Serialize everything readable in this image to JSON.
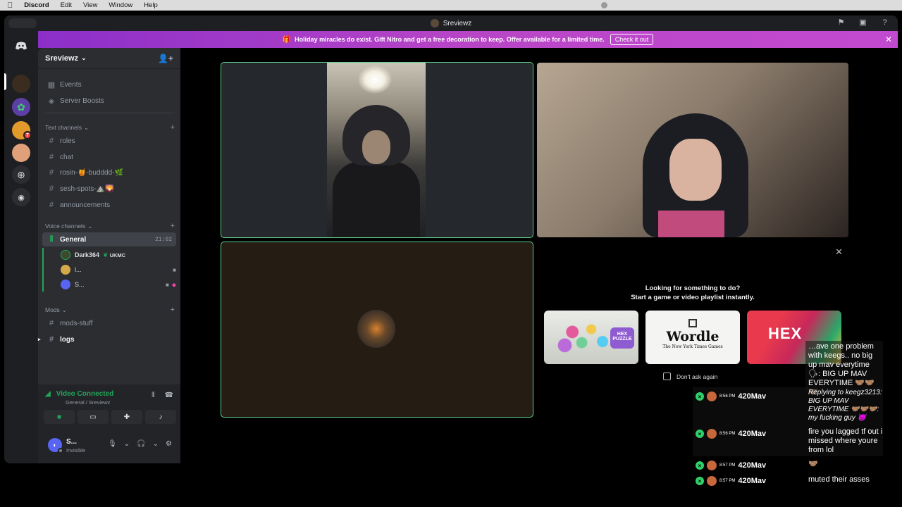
{
  "menubar": {
    "apple": "",
    "app": "Discord",
    "items": [
      "Edit",
      "View",
      "Window",
      "Help"
    ]
  },
  "window": {
    "title": "Sreviewz"
  },
  "banner": {
    "text": "Holiday miracles do exist. Gift Nitro and get a free decoration to keep. Offer available for a limited time.",
    "cta": "Check it out"
  },
  "server": {
    "name": "Sreviewz",
    "top_items": [
      "Events",
      "Server Boosts"
    ],
    "text_category": "Text channels",
    "text_channels": [
      "roles",
      "chat",
      "rosin-🍯-budddd-🌿",
      "sesh-spots-⛰️🌄",
      "announcements"
    ],
    "voice_category": "Voice channels",
    "voice_channel": {
      "name": "General",
      "time": "21:02"
    },
    "voice_users": [
      {
        "name": "Dark364",
        "tag": "UKMC"
      },
      {
        "name": "l..."
      },
      {
        "name": "S..."
      }
    ],
    "mods_category": "Mods",
    "mods_channels": [
      "mods-stuff",
      "logs"
    ]
  },
  "voice_status": {
    "status": "Video Connected",
    "sub": "General / Sreviewz"
  },
  "user": {
    "name": "S...",
    "status": "Invisible"
  },
  "guild_badge": "7",
  "activity": {
    "title_line1": "Looking for something to do?",
    "title_line2": "Start a game or video playlist instantly.",
    "cards": [
      "HEX PUZZLE",
      "Wordle",
      "HEX"
    ],
    "wordle_sub": "The New York Times Games",
    "dont_ask": "Don't ask again"
  },
  "chat_overlay": [
    {
      "time": "",
      "name": "",
      "text": "…ave one problem with keegs.. no big up mav everytime 🗣: BIG UP MAV EVERYTIME 🤝🏽🤝🏽🤝🏽",
      "italic": false
    },
    {
      "time": "8:56 PM",
      "name": "420Mav",
      "text": "Replying to keegz3213: BIG UP MAV EVERYTIME 🤝🏽🤝🏽🤝🏽: my fucking guy 😈",
      "italic": true
    },
    {
      "time": "8:56 PM",
      "name": "420Mav",
      "text": "fire you lagged tf out i missed where youre from lol",
      "italic": false
    },
    {
      "time": "8:57 PM",
      "name": "420Mav",
      "text": "🤝🏽",
      "italic": false
    },
    {
      "time": "8:57 PM",
      "name": "420Mav",
      "text": "muted their asses",
      "italic": false
    }
  ],
  "colors": {
    "accent_green": "#23a559",
    "blurple": "#5865f2",
    "banner": "#b845c6"
  }
}
